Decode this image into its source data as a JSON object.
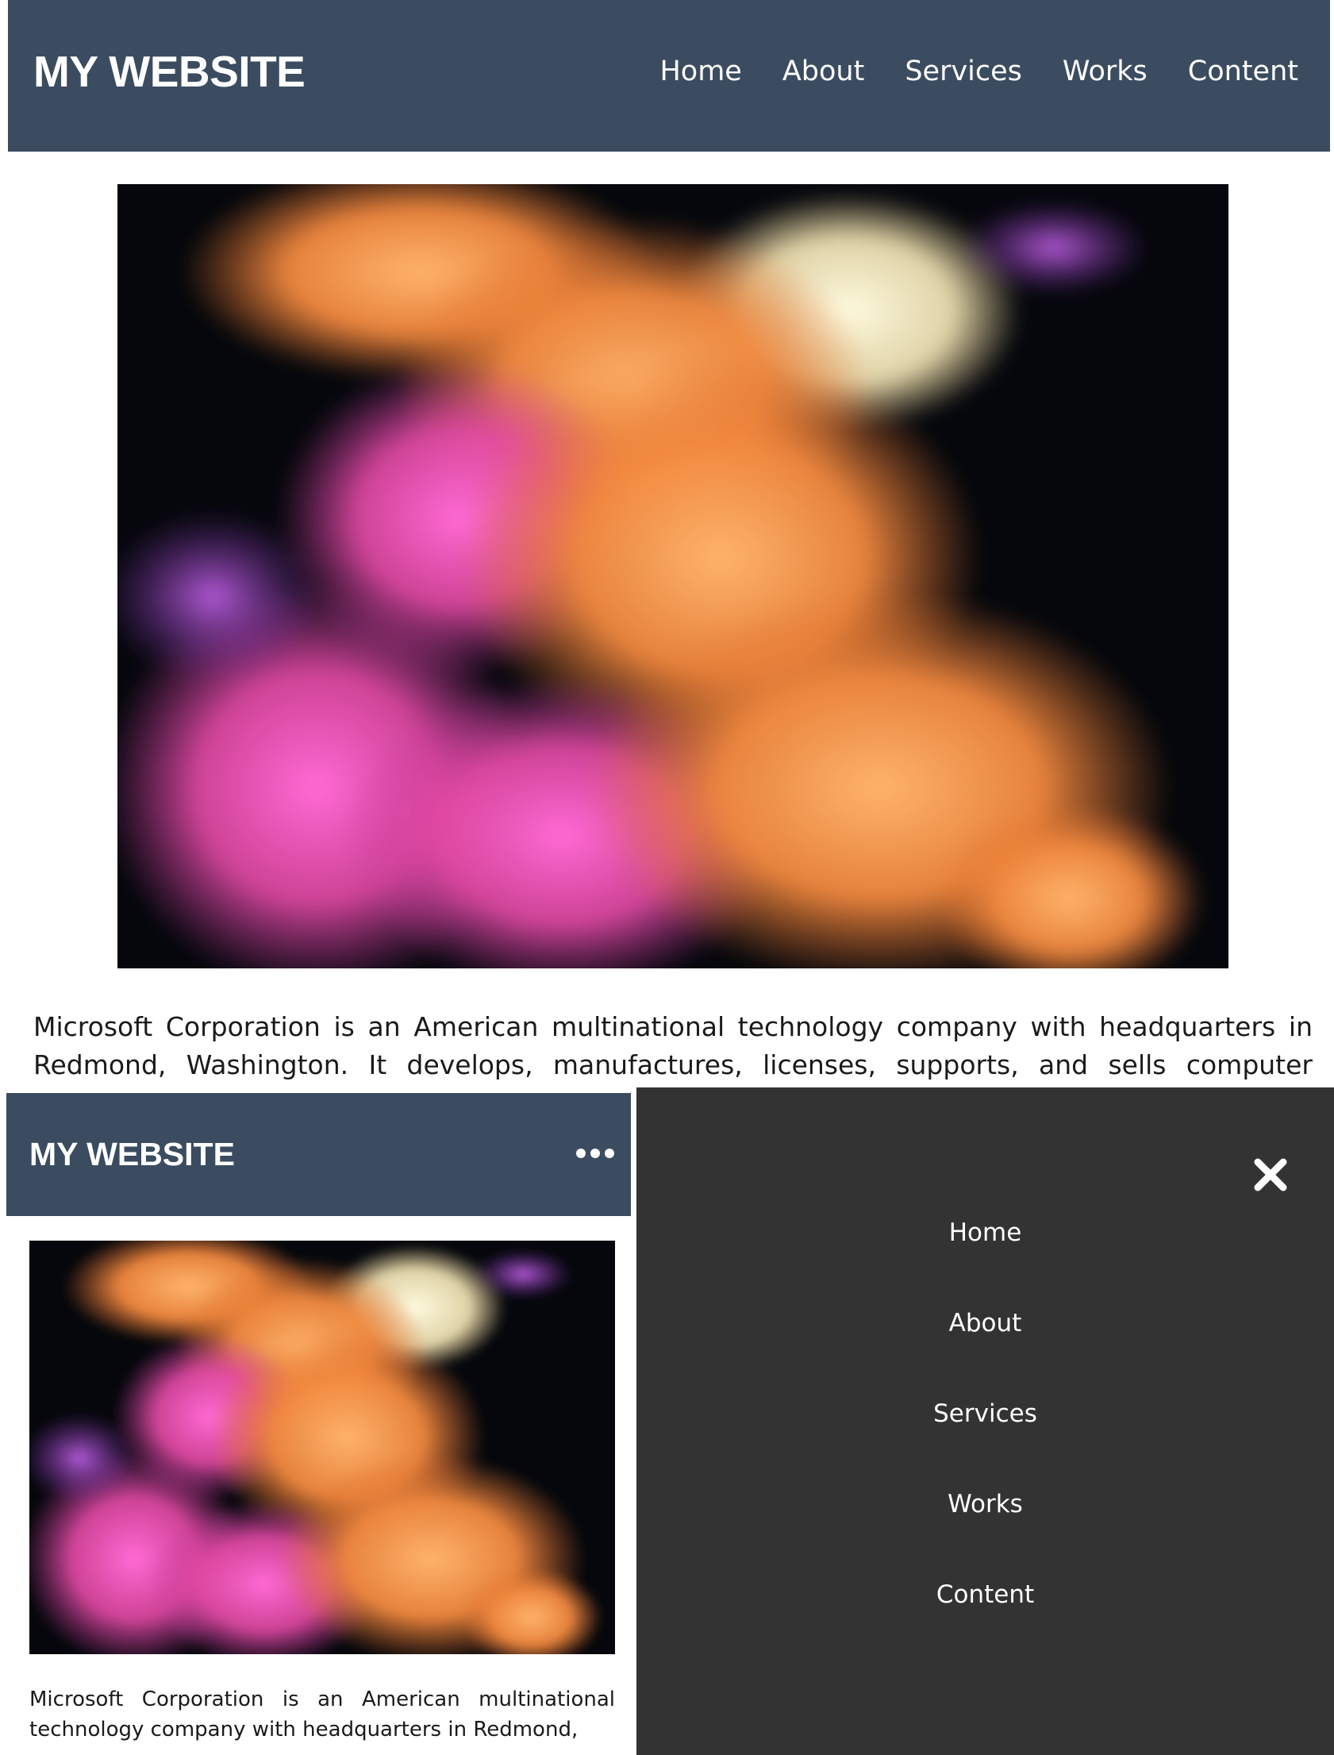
{
  "site": {
    "logo": "MY WEBSITE",
    "nav": [
      {
        "label": "Home"
      },
      {
        "label": "About"
      },
      {
        "label": "Services"
      },
      {
        "label": "Works"
      },
      {
        "label": "Content"
      }
    ],
    "body_text": "Microsoft Corporation is an American multinational technology company with headquarters in Redmond, Washington. It develops, manufactures, licenses, supports, and sells computer software,",
    "mobile_body_text": "Microsoft Corporation is an American multinational technology company with headquarters in Redmond,"
  },
  "mobile": {
    "menu_icon": "more-dots-icon",
    "close_icon": "close-icon"
  },
  "colors": {
    "header_bg": "#3b4c60",
    "overlay_bg": "#333333",
    "text_light": "#ffffff",
    "text_dark": "#1a1a1a"
  },
  "hero_image": {
    "description_icon": "abstract-ink-cloud-image"
  }
}
